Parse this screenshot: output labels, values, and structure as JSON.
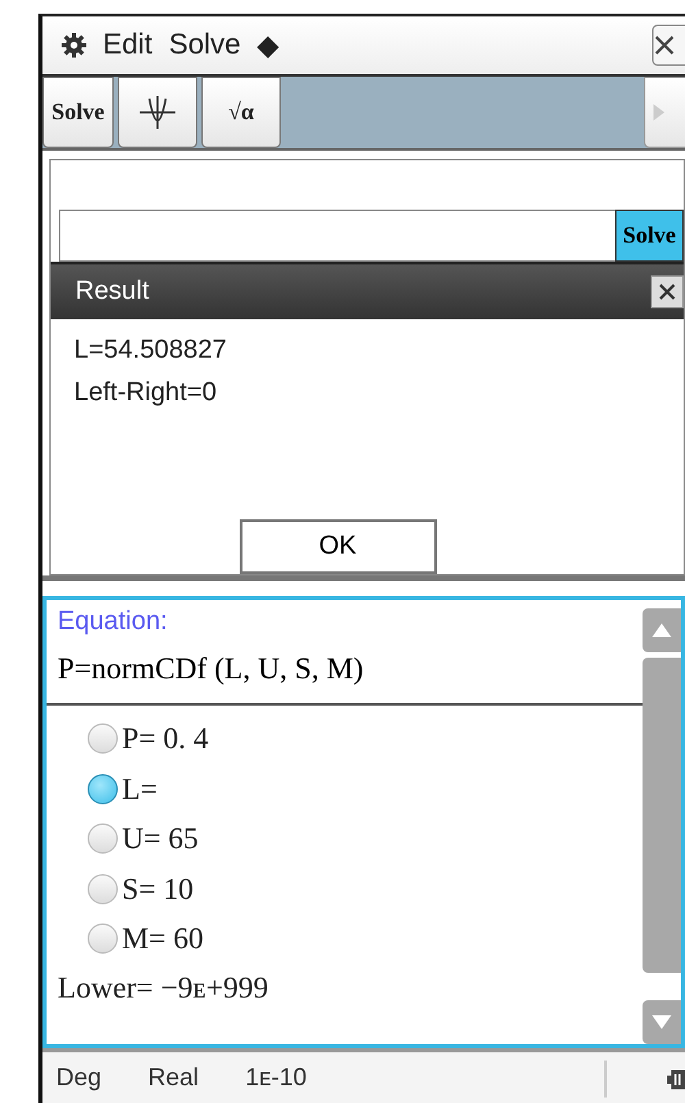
{
  "menu_bar": {
    "items": [
      "Edit",
      "Solve",
      "◆"
    ]
  },
  "toolbar": {
    "buttons": [
      {
        "kind": "text",
        "label": "Solve"
      },
      {
        "kind": "graph"
      },
      {
        "kind": "text",
        "label": "√α"
      }
    ]
  },
  "input_bar": {
    "button": "Solve"
  },
  "result_dialog": {
    "title": "Result",
    "lines": [
      "L=54.508827",
      "Left-Right=0"
    ],
    "ok_button": "OK"
  },
  "equation_panel": {
    "heading": "Equation:",
    "equation": "P=normCDf (L, U, S, M)",
    "variables": [
      {
        "label": "P= 0. 4",
        "selected": false
      },
      {
        "label": "L=",
        "selected": true
      },
      {
        "label": "U= 65",
        "selected": false
      },
      {
        "label": "S= 10",
        "selected": false
      },
      {
        "label": "M= 60",
        "selected": false
      }
    ],
    "bounds": [
      "Lower= −9ᴇ+999"
    ]
  },
  "status_bar": {
    "items": [
      "Deg",
      "Real",
      "1ᴇ-10"
    ]
  }
}
